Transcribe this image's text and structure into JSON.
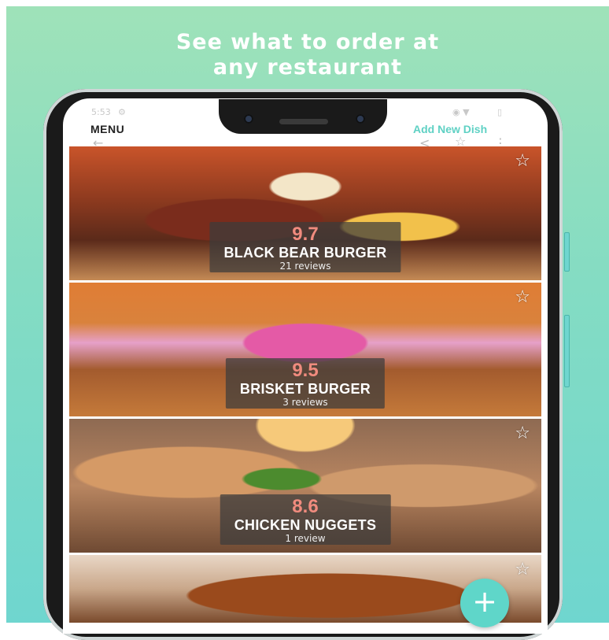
{
  "headline": {
    "line1": "See what to order at",
    "line2": "any restaurant"
  },
  "status_bar": {
    "time": "5:53"
  },
  "header": {
    "title": "MENU",
    "add_new_dish": "Add New Dish"
  },
  "icons": {
    "back": "back-arrow-icon",
    "share": "share-icon",
    "favorite": "star-icon",
    "more": "more-vertical-icon"
  },
  "dishes": [
    {
      "score": "9.7",
      "name": "BLACK BEAR BURGER",
      "reviews": "21 reviews"
    },
    {
      "score": "9.5",
      "name": "BRISKET BURGER",
      "reviews": "3 reviews"
    },
    {
      "score": "8.6",
      "name": "CHICKEN NUGGETS",
      "reviews": "1 review"
    },
    {
      "score": "",
      "name": "",
      "reviews": ""
    }
  ],
  "fab": {
    "label": "+"
  },
  "colors": {
    "accent": "#5fd6c9",
    "score": "#f08b7e",
    "background_top": "#9fe2b9",
    "background_bottom": "#6fd6cf"
  }
}
